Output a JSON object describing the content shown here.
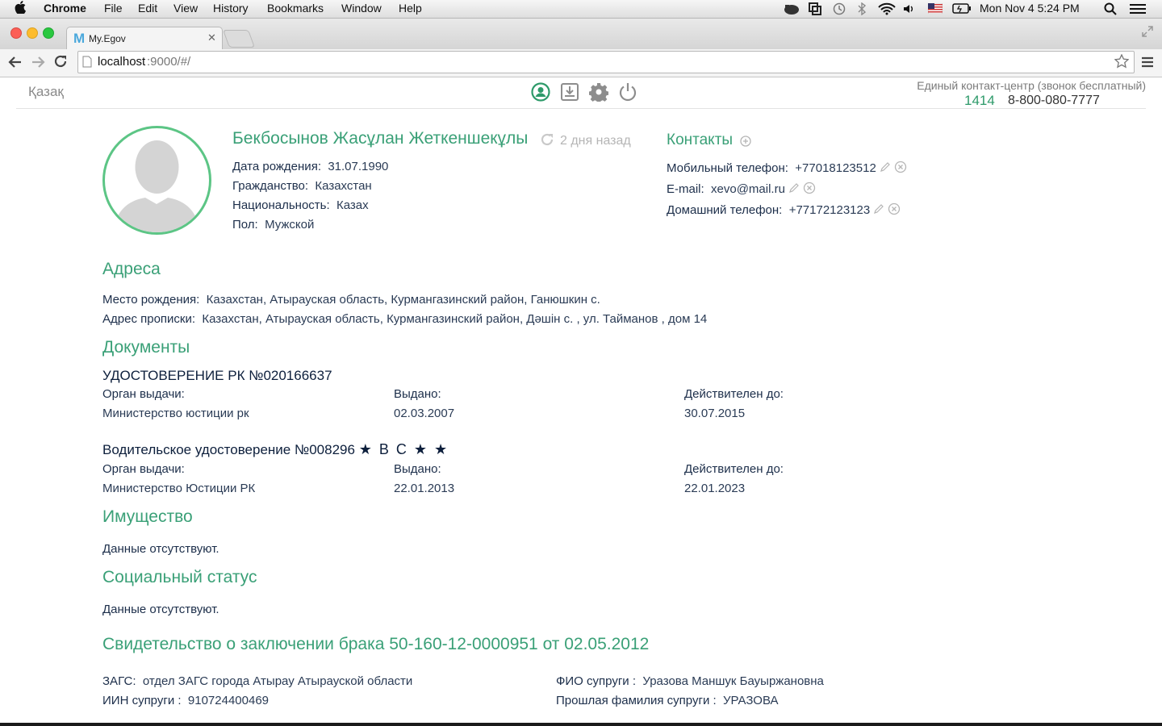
{
  "menubar": {
    "app": "Chrome",
    "menus": [
      "File",
      "Edit",
      "View",
      "History",
      "Bookmarks",
      "Window",
      "Help"
    ],
    "clock": "Mon Nov 4  5:24 PM"
  },
  "tab": {
    "title": "My.Egov",
    "favicon": "M"
  },
  "address": {
    "host": "localhost",
    "rest": ":9000/#/"
  },
  "header": {
    "lang": "Қазақ",
    "contact_caption": "Единый контакт-центр (звонок бесплатный)",
    "short_number": "1414",
    "phone": "8-800-080-7777"
  },
  "profile": {
    "name": "Бекбосынов Жасұлан Жеткеншекұлы",
    "updated": "2 дня назад",
    "fields": [
      {
        "label": "Дата рождения:",
        "value": "31.07.1990"
      },
      {
        "label": "Гражданство:",
        "value": "Казахстан"
      },
      {
        "label": "Национальность:",
        "value": "Казах"
      },
      {
        "label": "Пол:",
        "value": "Мужской"
      }
    ]
  },
  "contacts": {
    "title": "Контакты",
    "items": [
      {
        "label": "Мобильный телефон:",
        "value": "+77018123512"
      },
      {
        "label": "E-mail:",
        "value": "xevo@mail.ru"
      },
      {
        "label": "Домашний телефон:",
        "value": "+77172123123"
      }
    ]
  },
  "addresses": {
    "title": "Адреса",
    "birth_label": "Место рождения:",
    "birth_value": "Казахстан, Атырауская область, Курмангазинский район, Ганюшкин с.",
    "reg_label": "Адрес прописки:",
    "reg_value": "Казахстан, Атырауская область, Курмангазинский район, Дәшін с. , ул. Тайманов , дом 14"
  },
  "documents": {
    "title": "Документы",
    "items": [
      {
        "name": "УДОСТОВЕРЕНИЕ РК №020166637",
        "categories": "",
        "issuer_label": "Орган выдачи:",
        "issuer": "Министерство юстиции рк",
        "issued_label": "Выдано:",
        "issued": "02.03.2007",
        "valid_label": "Действителен до:",
        "valid": "30.07.2015"
      },
      {
        "name": "Водительское удостоверение №008296",
        "categories": "★ B C ★ ★",
        "issuer_label": "Орган выдачи:",
        "issuer": "Министерство Юстиции РК",
        "issued_label": "Выдано:",
        "issued": "22.01.2013",
        "valid_label": "Действителен до:",
        "valid": "22.01.2023"
      }
    ]
  },
  "property": {
    "title": "Имущество",
    "empty": "Данные отсутствуют."
  },
  "social": {
    "title": "Социальный статус",
    "empty": "Данные отсутствуют."
  },
  "marriage": {
    "title": "Свидетельство о заключении брака 50-160-12-0000951 от 02.05.2012",
    "zags_label": "ЗАГС:",
    "zags": "отдел ЗАГС города Атырау Атырауской области",
    "iin_label": "ИИН супруги :",
    "iin": "910724400469",
    "fio_label": "ФИО супруги :",
    "fio": "Уразова Маншук Бауыржановна",
    "prev_label": "Прошлая фамилия супруги :",
    "prev": "УРАЗОВА"
  },
  "colors": {
    "accent": "#2e9a6a",
    "navy": "#1c2e4a"
  }
}
